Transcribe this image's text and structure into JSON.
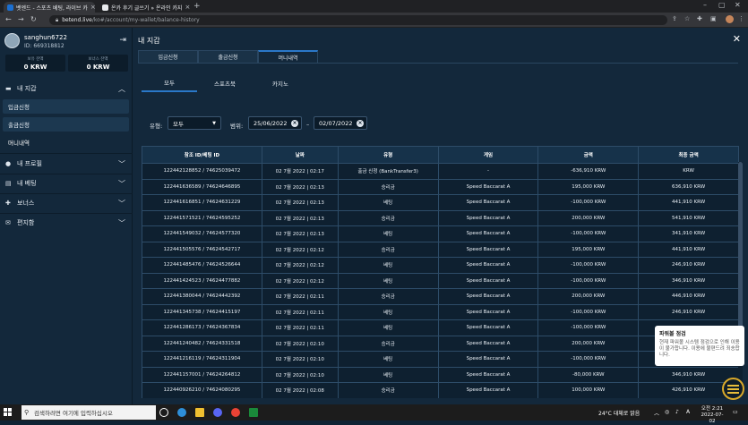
{
  "browser": {
    "tabs": [
      {
        "title": "벳엔드 - 스포츠 베팅, 라이브 카",
        "active": true
      },
      {
        "title": "온카 후기 글쓰기 » 온라인 카지",
        "active": false
      }
    ],
    "url_host": "betend.live",
    "url_path": "/ko#/account/my-wallet/balance-history"
  },
  "sidebar": {
    "username": "sanghun6722",
    "user_id": "ID: 669318812",
    "balances": [
      {
        "label": "보유 잔액",
        "value": "0 KRW"
      },
      {
        "label": "보너스 잔액",
        "value": "0 KRW"
      }
    ],
    "wallet": {
      "label": "내 지갑",
      "items": [
        "입금신청",
        "출금신청",
        "머니내역"
      ]
    },
    "nav": [
      {
        "label": "내 프로필",
        "icon": "user-icon"
      },
      {
        "label": "내 베팅",
        "icon": "bet-icon"
      },
      {
        "label": "보너스",
        "icon": "gift-icon"
      },
      {
        "label": "편지함",
        "icon": "mail-icon"
      }
    ]
  },
  "main": {
    "title": "내 지갑",
    "tabs": [
      "입금신청",
      "출금신청",
      "머니내역"
    ],
    "active_tab": "머니내역",
    "subtabs": [
      "모두",
      "스포츠북",
      "카지노"
    ],
    "active_subtab": "모두",
    "filter": {
      "type_label": "유형:",
      "type_value": "모두",
      "range_label": "범위:",
      "date_from": "25/06/2022",
      "date_to": "02/07/2022",
      "separator": "–"
    },
    "table": {
      "columns": [
        "참조 ID/베팅 ID",
        "날짜",
        "유형",
        "게임",
        "금액",
        "최종 금액"
      ],
      "rows": [
        [
          "122442128852 / 74625039472",
          "02 7월 2022 | 02:17",
          "출금 신청 (BankTransfer3)",
          "-",
          "-636,910 KRW",
          "KRW"
        ],
        [
          "122441636589 / 74624646895",
          "02 7월 2022 | 02:13",
          "승리금",
          "Speed Baccarat A",
          "195,000 KRW",
          "636,910 KRW"
        ],
        [
          "122441616851 / 74624631229",
          "02 7월 2022 | 02:13",
          "베팅",
          "Speed Baccarat A",
          "-100,000 KRW",
          "441,910 KRW"
        ],
        [
          "122441571521 / 74624595252",
          "02 7월 2022 | 02:13",
          "승리금",
          "Speed Baccarat A",
          "200,000 KRW",
          "541,910 KRW"
        ],
        [
          "122441549032 / 74624577320",
          "02 7월 2022 | 02:13",
          "베팅",
          "Speed Baccarat A",
          "-100,000 KRW",
          "341,910 KRW"
        ],
        [
          "122441505576 / 74624542717",
          "02 7월 2022 | 02:12",
          "승리금",
          "Speed Baccarat A",
          "195,000 KRW",
          "441,910 KRW"
        ],
        [
          "122441485476 / 74624526644",
          "02 7월 2022 | 02:12",
          "베팅",
          "Speed Baccarat A",
          "-100,000 KRW",
          "246,910 KRW"
        ],
        [
          "122441424523 / 74624477882",
          "02 7월 2022 | 02:12",
          "베팅",
          "Speed Baccarat A",
          "-100,000 KRW",
          "346,910 KRW"
        ],
        [
          "122441380044 / 74624442392",
          "02 7월 2022 | 02:11",
          "승리금",
          "Speed Baccarat A",
          "200,000 KRW",
          "446,910 KRW"
        ],
        [
          "122441345738 / 74624415197",
          "02 7월 2022 | 02:11",
          "베팅",
          "Speed Baccarat A",
          "-100,000 KRW",
          "246,910 KRW"
        ],
        [
          "122441286173 / 74624367834",
          "02 7월 2022 | 02:11",
          "베팅",
          "Speed Baccarat A",
          "-100,000 KRW",
          ""
        ],
        [
          "122441240482 / 74624331518",
          "02 7월 2022 | 02:10",
          "승리금",
          "Speed Baccarat A",
          "200,000 KRW",
          ""
        ],
        [
          "122441216119 / 74624311904",
          "02 7월 2022 | 02:10",
          "베팅",
          "Speed Baccarat A",
          "-100,000 KRW",
          ""
        ],
        [
          "122441157001 / 74624264812",
          "02 7월 2022 | 02:10",
          "베팅",
          "Speed Baccarat A",
          "-80,000 KRW",
          "346,910 KRW"
        ],
        [
          "122440926210 / 74624080295",
          "02 7월 2022 | 02:08",
          "승리금",
          "Speed Baccarat A",
          "100,000 KRW",
          "426,910 KRW"
        ]
      ]
    }
  },
  "toast": {
    "title": "파워볼 점검",
    "body": "현재 파워볼 시스템 점검으로 인해 이용이 불가합니다. 이용에 불편드려 죄송합니다."
  },
  "taskbar": {
    "search_placeholder": "검색하려면 여기에 입력하십시오",
    "weather": "24°C 대체로 맑음",
    "time_line1": "오전 2:21",
    "time_line2": "2022-07-02"
  },
  "colors": {
    "accent": "#2a78c8",
    "panel": "#13283b",
    "table_bg": "#0e2030"
  }
}
